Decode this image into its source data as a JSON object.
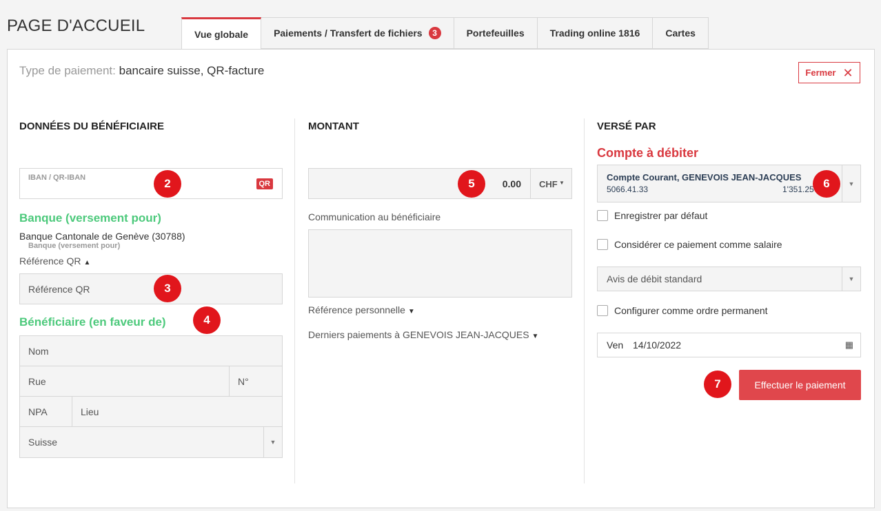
{
  "page_title": "PAGE D'ACCUEIL",
  "tabs": [
    {
      "label": "Vue globale"
    },
    {
      "label": "Paiements / Transfert de fichiers",
      "badge": "3"
    },
    {
      "label": "Portefeuilles"
    },
    {
      "label": "Trading online 1816"
    },
    {
      "label": "Cartes"
    }
  ],
  "payment_type": {
    "label": "Type de paiement:",
    "value": "bancaire suisse, QR-facture"
  },
  "close_label": "Fermer",
  "beneficiary": {
    "section_title": "DONNÉES DU BÉNÉFICIAIRE",
    "iban_label": "IBAN / QR-IBAN",
    "iban_value": "",
    "qr_badge": "QR",
    "bank_heading": "Banque (versement pour)",
    "bank_name": "Banque Cantonale de Genève (30788)",
    "bank_sublabel": "Banque (versement pour)",
    "qr_ref_toggle": "Référence QR",
    "qr_ref_placeholder": "Référence QR",
    "beneficiary_heading": "Bénéficiaire (en faveur de)",
    "name_placeholder": "Nom",
    "street_placeholder": "Rue",
    "number_placeholder": "N°",
    "zip_placeholder": "NPA",
    "city_placeholder": "Lieu",
    "country_value": "Suisse"
  },
  "amount": {
    "section_title": "MONTANT",
    "value": "0.00",
    "currency": "CHF",
    "communication_label": "Communication au bénéficiaire",
    "communication_value": "",
    "personal_ref_toggle": "Référence personnelle",
    "last_payments_toggle": "Derniers paiements à GENEVOIS JEAN-JACQUES"
  },
  "paid_by": {
    "section_title": "VERSÉ PAR",
    "debit_heading": "Compte à débiter",
    "account_name": "Compte Courant, GENEVOIS JEAN-JACQUES",
    "account_number": "5066.41.33",
    "account_balance": "1'351.25",
    "save_default_label": "Enregistrer par défaut",
    "salary_label": "Considérer ce paiement comme salaire",
    "debit_advice_value": "Avis de débit standard",
    "standing_order_label": "Configurer comme ordre permanent",
    "date_label": "Ven",
    "date_value": "14/10/2022",
    "submit_label": "Effectuer le paiement"
  },
  "markers": [
    "2",
    "3",
    "4",
    "5",
    "6",
    "7"
  ],
  "colors": {
    "accent_red": "#d9383f",
    "marker_red": "#e1161c",
    "green": "#4cc97b"
  }
}
